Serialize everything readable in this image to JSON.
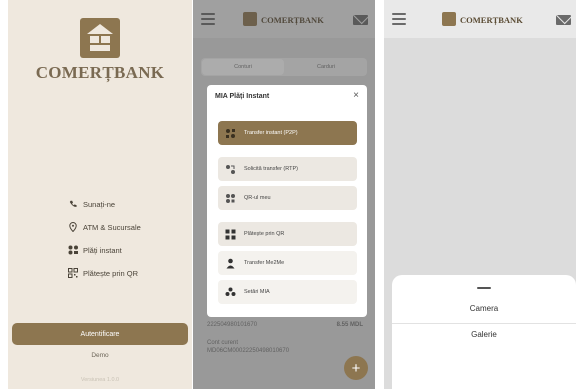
{
  "brand": {
    "name": "COMERȚBANK",
    "accent": "#8d7650"
  },
  "login": {
    "menu": [
      {
        "label": "Sunați-ne",
        "icon": "phone-icon"
      },
      {
        "label": "ATM & Sucursale",
        "icon": "location-icon"
      },
      {
        "label": "Plăți instant",
        "icon": "instant-pay-icon"
      },
      {
        "label": "Plătește prin QR",
        "icon": "qr-code-icon"
      }
    ],
    "auth_button": "Autentificare",
    "demo_link": "Demo",
    "version": "Versiunea 1.0.0"
  },
  "app": {
    "tabs": [
      "Conturi",
      "Carduri"
    ],
    "account_partial": {
      "number": "22250498010167​0",
      "amount": "8.55 MDL"
    },
    "account_label": "Cont curent",
    "account_iban": "MD06CM0002225049801067​0",
    "fab": "+"
  },
  "dialog": {
    "title": "MIA Plăți Instant",
    "close": "×",
    "options": [
      {
        "label": "Transfer instant (P2P)",
        "icon": "p2p-transfer-icon"
      },
      {
        "label": "Solicită transfer (RTP)",
        "icon": "request-transfer-icon"
      },
      {
        "label": "QR-ul meu",
        "icon": "my-qr-icon"
      },
      {
        "label": "Plătește prin QR",
        "icon": "qr-pay-icon"
      },
      {
        "label": "Transfer Me2Me",
        "icon": "me2me-icon"
      },
      {
        "label": "Setări MIA",
        "icon": "settings-icon"
      }
    ]
  },
  "sheet": {
    "camera": "Camera",
    "gallery": "Galerie"
  }
}
